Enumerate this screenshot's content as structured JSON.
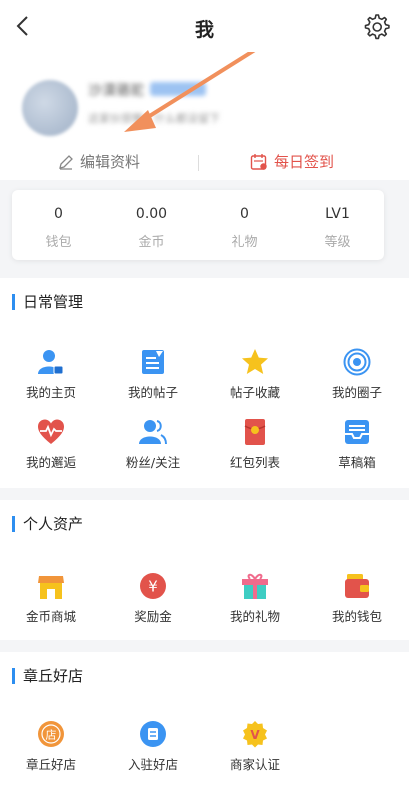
{
  "header": {
    "title": "我",
    "back_icon": "chevron-left-icon",
    "settings_icon": "gear-icon"
  },
  "profile": {
    "name_blurred": "沙漠骆驼",
    "sub_blurred": "这家伙很懒，什么都没留下",
    "edit_label": "编辑资料",
    "signin_label": "每日签到",
    "accent_color": "#e2534b"
  },
  "stats": [
    {
      "value": "0",
      "label": "钱包"
    },
    {
      "value": "0.00",
      "label": "金币"
    },
    {
      "value": "0",
      "label": "礼物"
    },
    {
      "value": "LV1",
      "label": "等级"
    }
  ],
  "sections": {
    "daily": {
      "title": "日常管理",
      "items": [
        {
          "label": "我的主页",
          "icon": "person-icon"
        },
        {
          "label": "我的帖子",
          "icon": "post-icon"
        },
        {
          "label": "帖子收藏",
          "icon": "star-icon"
        },
        {
          "label": "我的圈子",
          "icon": "target-icon"
        },
        {
          "label": "我的邂逅",
          "icon": "heart-pulse-icon"
        },
        {
          "label": "粉丝/关注",
          "icon": "followers-icon"
        },
        {
          "label": "红包列表",
          "icon": "red-packet-icon"
        },
        {
          "label": "草稿箱",
          "icon": "drafts-icon"
        }
      ]
    },
    "assets": {
      "title": "个人资产",
      "items": [
        {
          "label": "金币商城",
          "icon": "shop-icon"
        },
        {
          "label": "奖励金",
          "icon": "yen-icon"
        },
        {
          "label": "我的礼物",
          "icon": "gift-icon"
        },
        {
          "label": "我的钱包",
          "icon": "wallet-icon"
        }
      ]
    },
    "store": {
      "title": "章丘好店",
      "items": [
        {
          "label": "章丘好店",
          "icon": "store-badge-icon",
          "glyph": "店"
        },
        {
          "label": "入驻好店",
          "icon": "enter-store-icon"
        },
        {
          "label": "商家认证",
          "icon": "verified-badge-icon",
          "glyph": "V"
        }
      ]
    }
  },
  "colors": {
    "brand_blue": "#2d8ef0",
    "icon_blue": "#3b94f2",
    "red": "#e2534b",
    "orange": "#f1953a",
    "yellow": "#f6c21d"
  }
}
